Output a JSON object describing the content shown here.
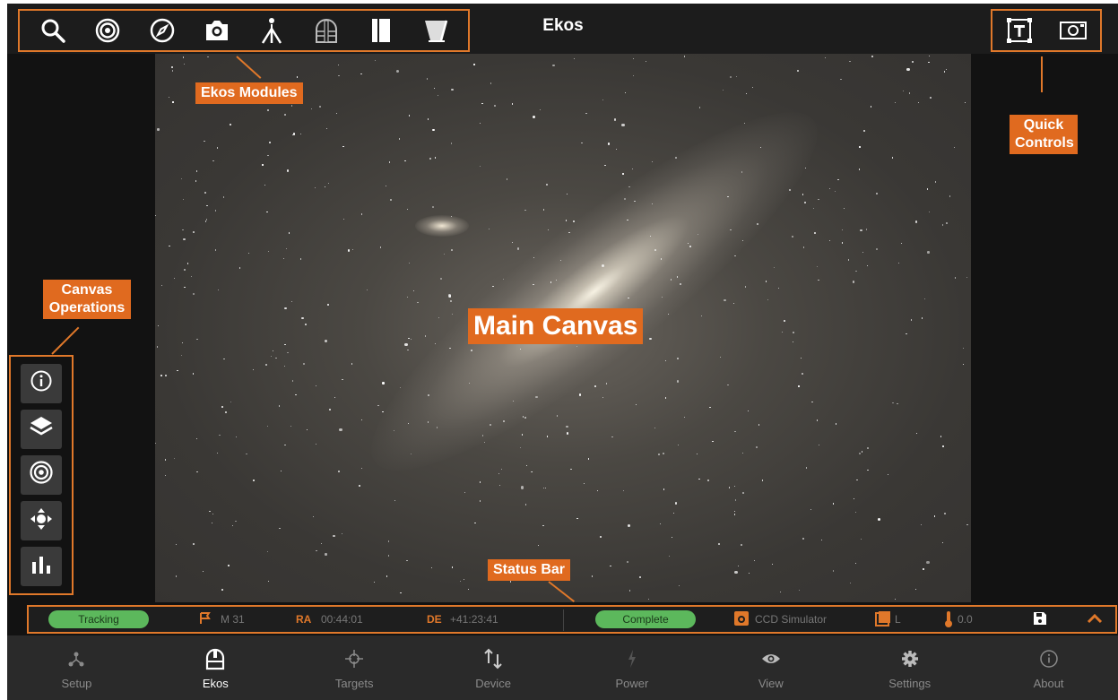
{
  "app_title": "Ekos",
  "top_modules": [
    {
      "icon": "search-icon"
    },
    {
      "icon": "target-icon"
    },
    {
      "icon": "compass-icon"
    },
    {
      "icon": "camera-icon"
    },
    {
      "icon": "tripod-icon"
    },
    {
      "icon": "dome-icon"
    },
    {
      "icon": "cap-icon"
    },
    {
      "icon": "flat-panel-icon"
    }
  ],
  "quick_controls": [
    {
      "icon": "text-frame-icon"
    },
    {
      "icon": "capture-frame-icon"
    }
  ],
  "canvas_operations": [
    {
      "icon": "info-icon"
    },
    {
      "icon": "layers-icon"
    },
    {
      "icon": "target-icon"
    },
    {
      "icon": "move-icon"
    },
    {
      "icon": "histogram-icon"
    }
  ],
  "annotations": {
    "ekos_modules": "Ekos Modules",
    "quick_controls_line1": "Quick",
    "quick_controls_line2": "Controls",
    "canvas_ops_line1": "Canvas",
    "canvas_ops_line2": "Operations",
    "main_canvas": "Main Canvas",
    "status_bar": "Status Bar"
  },
  "status": {
    "tracking": "Tracking",
    "target": "M 31",
    "ra_label": "RA",
    "ra_value": "00:44:01",
    "de_label": "DE",
    "de_value": "+41:23:41",
    "capture_state": "Complete",
    "camera": "CCD Simulator",
    "filter": "L",
    "temperature": "0.0"
  },
  "nav": [
    {
      "label": "Setup",
      "icon": "setup-icon",
      "active": false
    },
    {
      "label": "Ekos",
      "icon": "ekos-icon",
      "active": true
    },
    {
      "label": "Targets",
      "icon": "crosshair-icon",
      "active": false
    },
    {
      "label": "Device",
      "icon": "device-arrows-icon",
      "active": false
    },
    {
      "label": "Power",
      "icon": "power-icon",
      "active": false
    },
    {
      "label": "View",
      "icon": "eye-icon",
      "active": false
    },
    {
      "label": "Settings",
      "icon": "gear-icon",
      "active": false
    },
    {
      "label": "About",
      "icon": "about-icon",
      "active": false
    }
  ],
  "colors": {
    "accent": "#e0782a",
    "ok_green": "#5cb85c"
  }
}
